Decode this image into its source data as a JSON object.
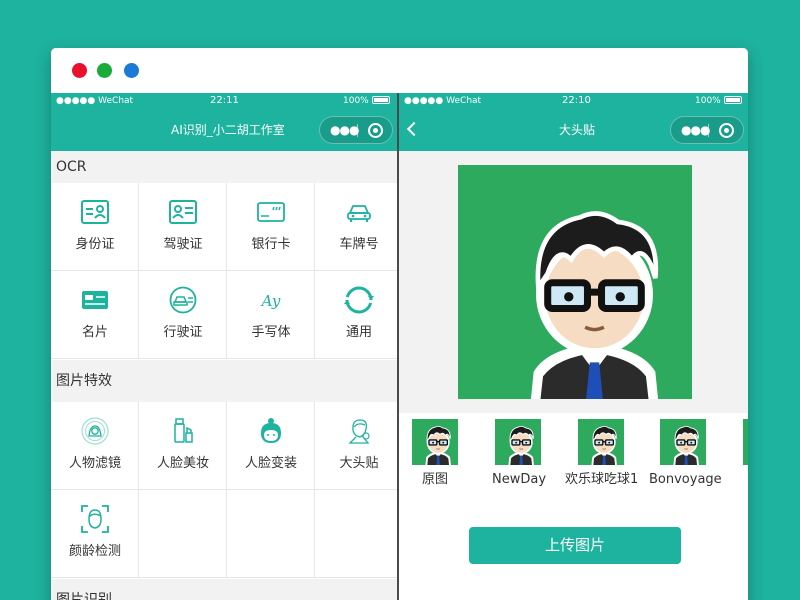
{
  "window_controls": [
    {
      "name": "close",
      "color": "#e8102c"
    },
    {
      "name": "minimize",
      "color": "#1aab3a"
    },
    {
      "name": "maximize",
      "color": "#1a7ad6"
    }
  ],
  "left_phone": {
    "status": {
      "carrier": "●●●●● WeChat",
      "time": "22:11",
      "battery": "100%"
    },
    "nav_title": "AI识别_小二胡工作室",
    "sections": [
      {
        "title": "OCR",
        "items": [
          {
            "label": "身份证",
            "icon": "id-card-icon"
          },
          {
            "label": "驾驶证",
            "icon": "driver-license-icon"
          },
          {
            "label": "银行卡",
            "icon": "bank-card-icon"
          },
          {
            "label": "车牌号",
            "icon": "car-icon"
          },
          {
            "label": "名片",
            "icon": "business-card-icon"
          },
          {
            "label": "行驶证",
            "icon": "vehicle-license-icon"
          },
          {
            "label": "手写体",
            "icon": "handwriting-icon"
          },
          {
            "label": "通用",
            "icon": "general-ocr-icon"
          }
        ]
      },
      {
        "title": "图片特效",
        "items": [
          {
            "label": "人物滤镜",
            "icon": "portrait-filter-icon"
          },
          {
            "label": "人脸美妆",
            "icon": "makeup-icon"
          },
          {
            "label": "人脸变装",
            "icon": "face-costume-icon"
          },
          {
            "label": "大头贴",
            "icon": "sticker-icon"
          },
          {
            "label": "颜龄检测",
            "icon": "age-detect-icon"
          }
        ]
      },
      {
        "title": "图片识别",
        "items": []
      }
    ]
  },
  "right_phone": {
    "status": {
      "carrier": "●●●●● WeChat",
      "time": "22:10",
      "battery": "100%"
    },
    "nav_title": "大头贴",
    "preview_icon": "cartoon-avatar-icon",
    "styles": [
      {
        "label": "原图"
      },
      {
        "label": "NewDay"
      },
      {
        "label": "欢乐球吃球1"
      },
      {
        "label": "Bonvoyage"
      }
    ],
    "upload_label": "上传图片"
  },
  "colors": {
    "accent": "#1db39e",
    "preview_bg": "#2eaa5f",
    "icon": "#1db39e"
  }
}
